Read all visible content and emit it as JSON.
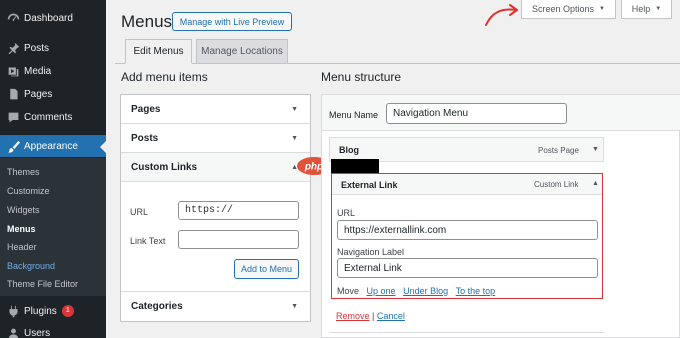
{
  "sidebar": {
    "items": [
      {
        "label": "Dashboard",
        "icon": "dashboard-icon"
      },
      {
        "label": "Posts",
        "icon": "pin-icon"
      },
      {
        "label": "Media",
        "icon": "media-icon"
      },
      {
        "label": "Pages",
        "icon": "page-icon"
      },
      {
        "label": "Comments",
        "icon": "comment-icon"
      },
      {
        "label": "Appearance",
        "icon": "brush-icon"
      },
      {
        "label": "Plugins",
        "icon": "plugin-icon",
        "badge": "1"
      },
      {
        "label": "Users",
        "icon": "users-icon"
      }
    ],
    "submenu": [
      "Themes",
      "Customize",
      "Widgets",
      "Menus",
      "Header",
      "Background",
      "Theme File Editor"
    ]
  },
  "header": {
    "title": "Menus",
    "live_preview": "Manage with Live Preview",
    "screen_options": "Screen Options",
    "help": "Help"
  },
  "tabs": [
    {
      "label": "Edit Menus"
    },
    {
      "label": "Manage Locations"
    }
  ],
  "left": {
    "title": "Add menu items",
    "accordion": {
      "pages": "Pages",
      "posts": "Posts",
      "custom_links": "Custom Links",
      "categories": "Categories"
    },
    "url_label": "URL",
    "url_value": "https://",
    "link_text_label": "Link Text",
    "link_text_value": "",
    "add_button": "Add to Menu"
  },
  "logo_text": "php",
  "right": {
    "title": "Menu structure",
    "menu_name_label": "Menu Name",
    "menu_name_value": "Navigation Menu",
    "blog": {
      "title": "Blog",
      "type": "Posts Page"
    },
    "external": {
      "title": "External Link",
      "type": "Custom Link",
      "url_label": "URL",
      "url_value": "https://externallink.com",
      "nav_label": "Navigation Label",
      "nav_value": "External Link",
      "move_label": "Move",
      "move_links": [
        "Up one",
        "Under Blog",
        "To the top"
      ],
      "remove": "Remove",
      "separator": "|",
      "cancel": "Cancel"
    }
  },
  "colors": {
    "sidebar_bg": "#1d2327",
    "active_blue": "#2271b1",
    "highlight_red": "#d63638",
    "annotation_red": "#e0302c"
  }
}
